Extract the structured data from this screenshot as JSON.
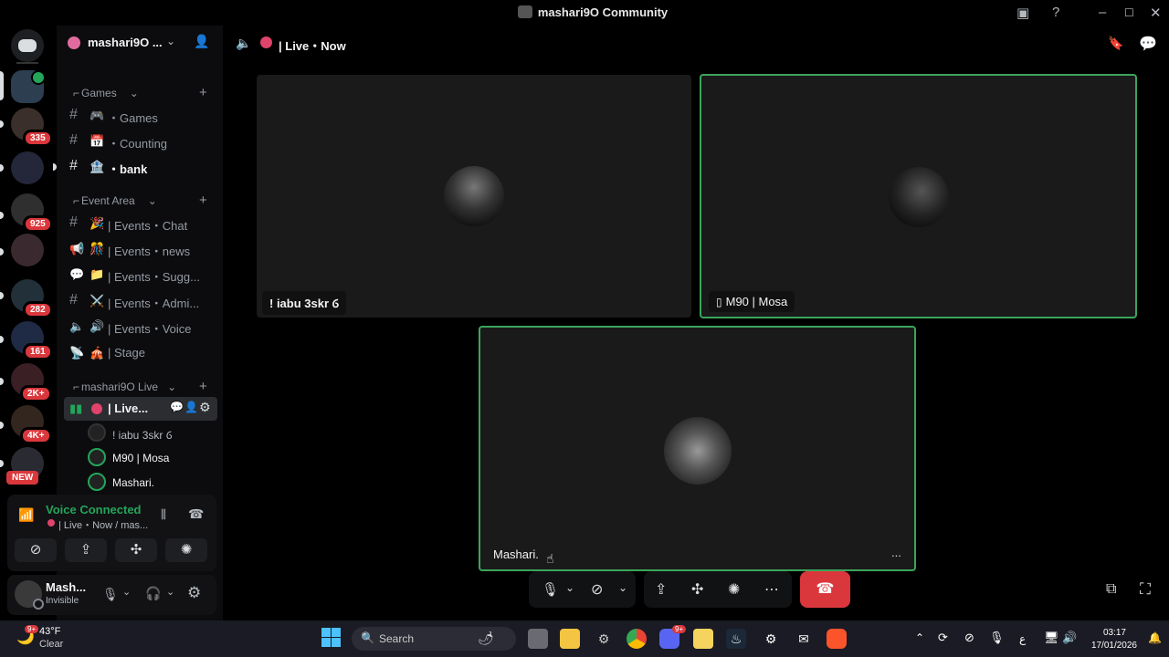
{
  "window": {
    "title": "mashari9O Community"
  },
  "server_rail": {
    "badges": [
      "335",
      "925",
      "282",
      "161",
      "2K+",
      "4K+"
    ],
    "new_label": "NEW"
  },
  "server": {
    "name": "mashari9O ..."
  },
  "categories": {
    "games": "Games",
    "event_area": "Event Area",
    "live": "mashari9O Live"
  },
  "channels": {
    "games": [
      {
        "name": "・Games",
        "emoji": "🎮"
      },
      {
        "name": "・Counting",
        "emoji": "📅"
      },
      {
        "name": "・bank",
        "emoji": "🏦"
      }
    ],
    "events": [
      {
        "name": "| Events・Chat",
        "emoji": "🎉"
      },
      {
        "name": "| Events・news",
        "emoji": "🎊"
      },
      {
        "name": "| Events・Sugg...",
        "emoji": "📁"
      },
      {
        "name": "| Events・Admi...",
        "emoji": "⚔️"
      },
      {
        "name": "| Events・Voice",
        "emoji": "🔊"
      },
      {
        "name": "| Stage",
        "emoji": "🎪"
      }
    ],
    "live": {
      "name": "| Live..."
    }
  },
  "voice_users": [
    {
      "name": "! iabu 3skr ⳓ"
    },
    {
      "name": "M90 | Mosa"
    },
    {
      "name": "Mashari."
    }
  ],
  "voice_panel": {
    "status": "Voice Connected",
    "channel": "| Live・Now / mas..."
  },
  "user": {
    "name": "Mash...",
    "status": "Invisible"
  },
  "header": {
    "channel": "| Live・Now"
  },
  "tiles": [
    {
      "name": "! iabu 3skr ⳓ"
    },
    {
      "name": "M90 | Mosa"
    },
    {
      "name": "Mashari."
    }
  ],
  "tile_menu": "...",
  "taskbar": {
    "weather_temp": "43°F",
    "weather_desc": "Clear",
    "weather_badge": "9+",
    "search_placeholder": "Search",
    "time": "03:17",
    "date": "17/01/2026",
    "lang": "ع"
  },
  "colors": {
    "accent_green": "#3ba55c",
    "danger_red": "#da373c",
    "discord_blurple": "#5865f2"
  }
}
